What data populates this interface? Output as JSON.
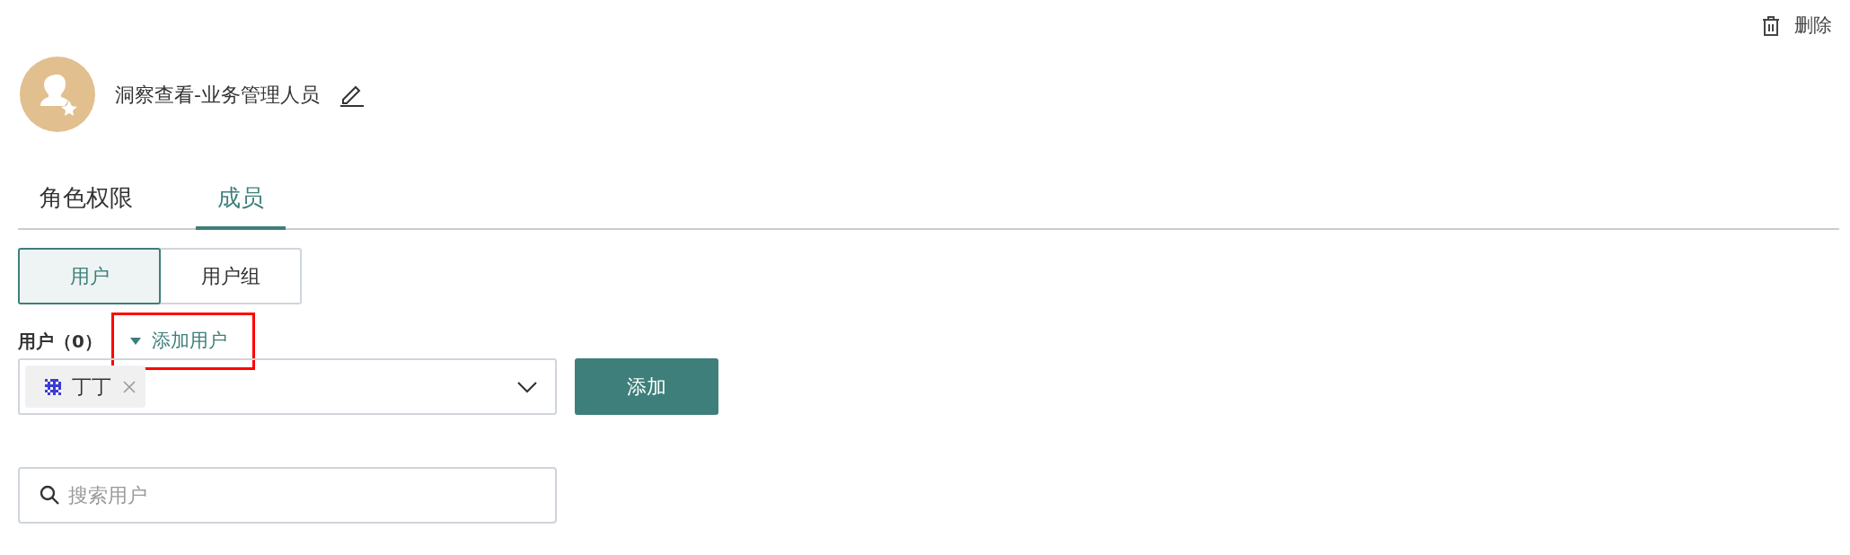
{
  "toolbar": {
    "delete_label": "删除"
  },
  "role": {
    "name": "洞察查看-业务管理人员"
  },
  "tabs": [
    {
      "label": "角色权限",
      "selected": false
    },
    {
      "label": "成员",
      "selected": true
    }
  ],
  "segments": [
    {
      "label": "用户",
      "selected": true
    },
    {
      "label": "用户组",
      "selected": false
    }
  ],
  "users": {
    "label": "用户（0）",
    "add_link": {
      "label": "添加用户",
      "highlighted": true
    },
    "selected_tags": [
      {
        "label": "丁丁"
      }
    ],
    "add_button": "添加",
    "search": {
      "placeholder": "搜索用户"
    }
  }
}
